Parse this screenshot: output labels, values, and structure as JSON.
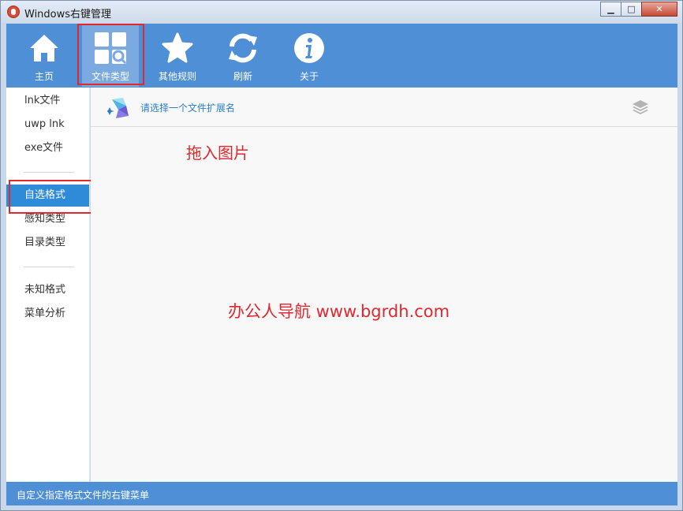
{
  "window": {
    "title": "Windows右键管理"
  },
  "toolbar": {
    "items": [
      {
        "label": "主页",
        "icon": "home-icon"
      },
      {
        "label": "文件类型",
        "icon": "file-type-icon"
      },
      {
        "label": "其他规则",
        "icon": "star-icon"
      },
      {
        "label": "刷新",
        "icon": "refresh-icon"
      },
      {
        "label": "关于",
        "icon": "info-icon"
      }
    ],
    "active_index": 1
  },
  "sidebar": {
    "groups": [
      [
        "lnk文件",
        "uwp lnk",
        "exe文件"
      ],
      [
        "自选格式",
        "感知类型",
        "目录类型"
      ],
      [
        "未知格式",
        "菜单分析"
      ]
    ],
    "selected": "自选格式"
  },
  "main": {
    "hint": "请选择一个文件扩展名",
    "drop_text": "拖入图片",
    "watermark": "办公人导航 www.bgrdh.com"
  },
  "statusbar": {
    "text": "自定义指定格式文件的右键菜单"
  },
  "colors": {
    "accent": "#4f8fd6",
    "selected": "#2f8bd8",
    "annotation": "#e0282e"
  }
}
